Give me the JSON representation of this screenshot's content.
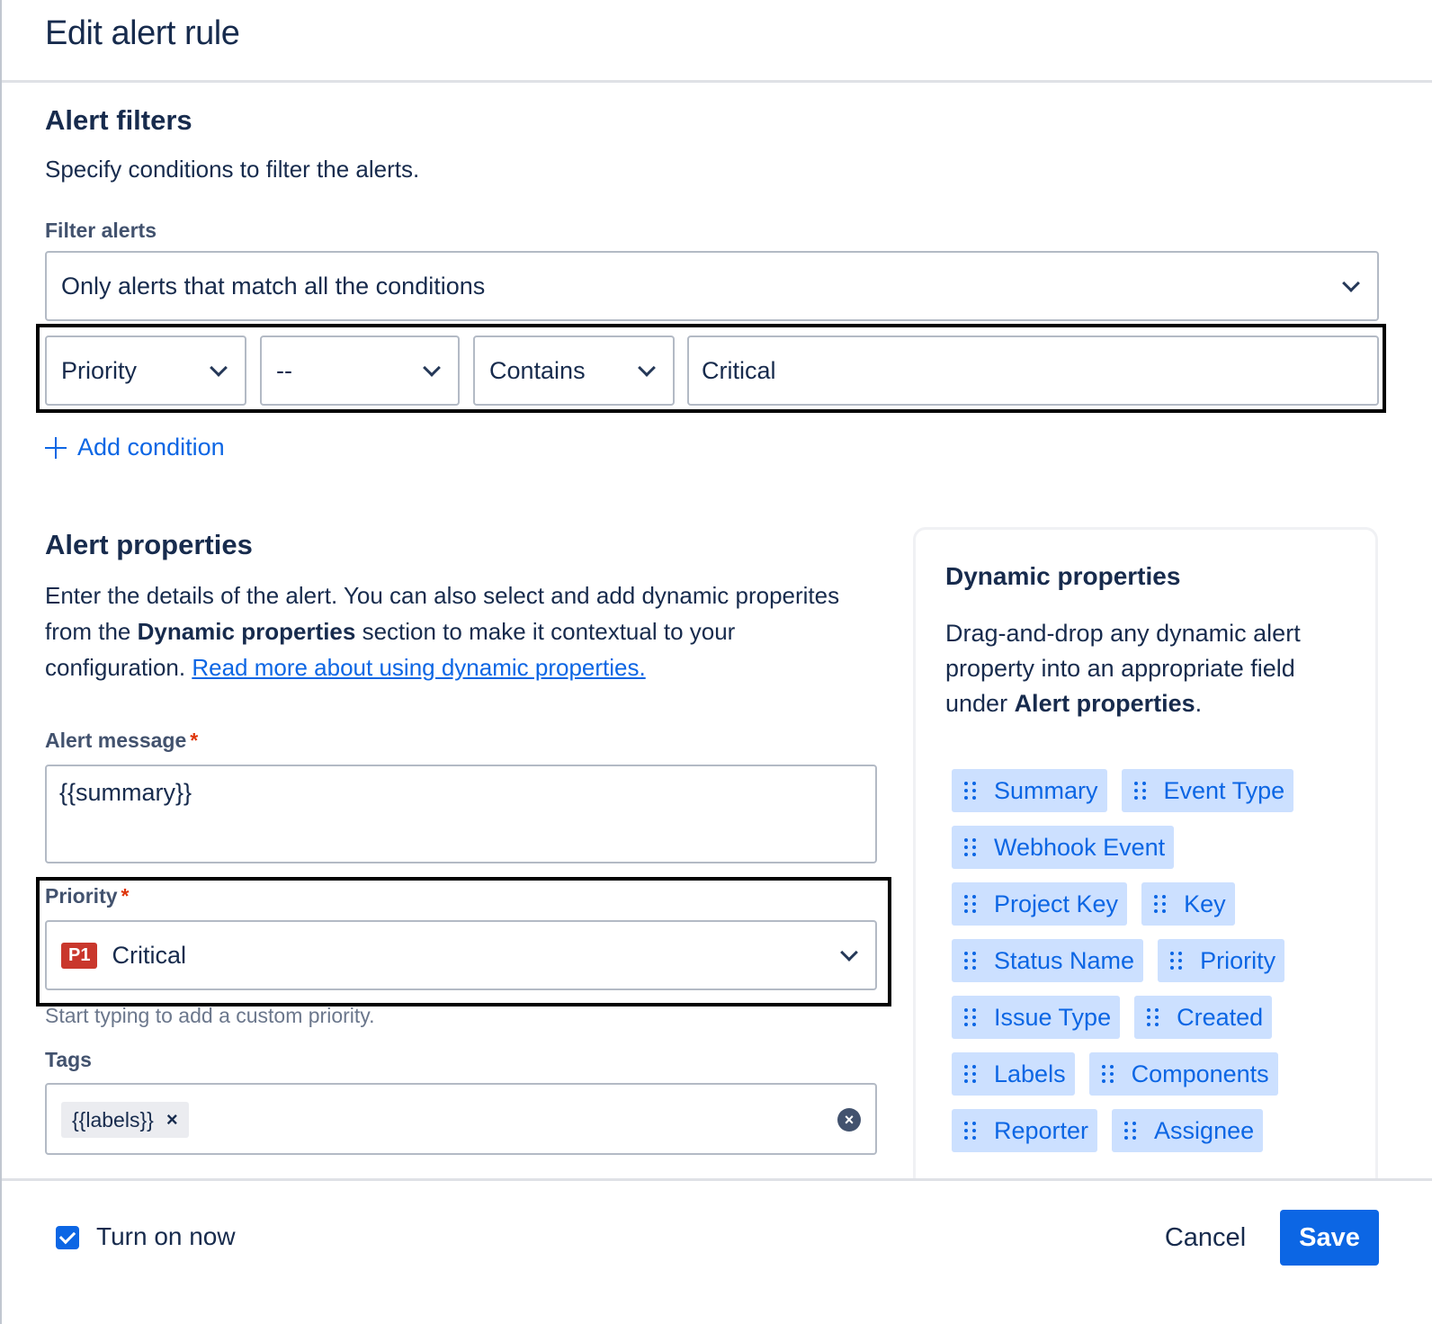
{
  "header": {
    "title": "Edit alert rule"
  },
  "filters": {
    "title": "Alert filters",
    "description": "Specify conditions to filter the alerts.",
    "filter_label": "Filter alerts",
    "filter_value": "Only alerts that match all the conditions",
    "condition": {
      "field": "Priority",
      "qualifier": "--",
      "operator": "Contains",
      "value": "Critical"
    },
    "add_condition_label": "Add condition"
  },
  "properties": {
    "title": "Alert properties",
    "desc_part1": "Enter the details of the alert. You can also select and add dynamic properites from the ",
    "desc_bold": "Dynamic properties",
    "desc_part2": " section to make it contextual to your configuration. ",
    "desc_link": "Read more about using dynamic properties.",
    "message_label": "Alert message",
    "message_value": "{{summary}}",
    "priority_label": "Priority",
    "priority_badge": "P1",
    "priority_value": "Critical",
    "priority_helper": "Start typing to add a custom priority.",
    "tags_label": "Tags",
    "tags": [
      "{{labels}}"
    ],
    "required_marker": "*"
  },
  "dynamic": {
    "title": "Dynamic properties",
    "desc_part1": "Drag-and-drop any dynamic alert property into an appropriate field under ",
    "desc_bold": "Alert properties",
    "desc_part2": ".",
    "chip_rows": [
      [
        "Summary",
        "Event Type"
      ],
      [
        "Webhook Event"
      ],
      [
        "Project Key",
        "Key"
      ],
      [
        "Status Name",
        "Priority"
      ],
      [
        "Issue Type",
        "Created"
      ],
      [
        "Labels",
        "Components"
      ],
      [
        "Reporter",
        "Assignee"
      ]
    ]
  },
  "footer": {
    "turn_on_label": "Turn on now",
    "turn_on_checked": true,
    "cancel_label": "Cancel",
    "save_label": "Save"
  },
  "colors": {
    "accent": "#0c66e4",
    "chip_bg": "#cce0ff",
    "p1_badge": "#c9372c",
    "required": "#de350b"
  }
}
